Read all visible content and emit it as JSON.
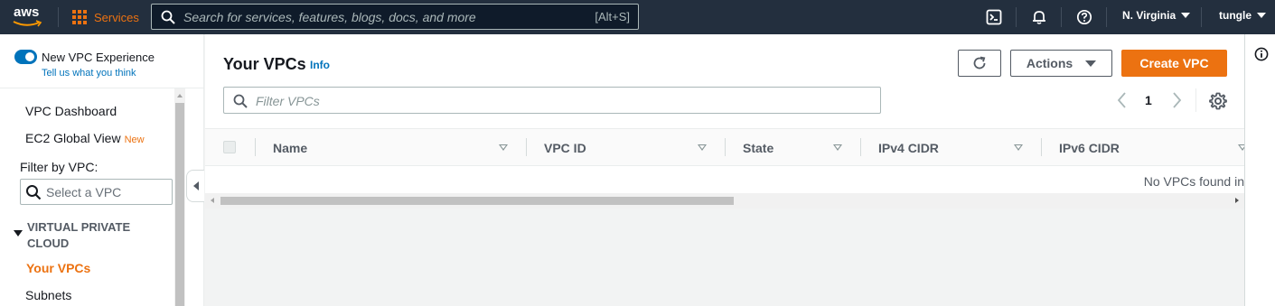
{
  "topnav": {
    "logo_text": "aws",
    "services_label": "Services",
    "search_placeholder": "Search for services, features, blogs, docs, and more",
    "search_shortcut": "[Alt+S]",
    "region": "N. Virginia",
    "user": "tungle",
    "icons": [
      "cloudshell-icon",
      "bell-icon",
      "help-icon"
    ]
  },
  "sidebar": {
    "toggle_label": "New VPC Experience",
    "tell_us": "Tell us what you think",
    "items": [
      {
        "label": "VPC Dashboard"
      },
      {
        "label": "EC2 Global View",
        "badge": "New"
      }
    ],
    "filter_label": "Filter by VPC:",
    "filter_placeholder": "Select a VPC",
    "section_title": "VIRTUAL PRIVATE CLOUD",
    "section_items": [
      {
        "label": "Your VPCs",
        "active": true
      },
      {
        "label": "Subnets",
        "active": false
      }
    ]
  },
  "main": {
    "title": "Your VPCs",
    "info": "Info",
    "actions_label": "Actions",
    "create_label": "Create VPC",
    "filter_placeholder": "Filter VPCs",
    "page": "1",
    "columns": [
      "Name",
      "VPC ID",
      "State",
      "IPv4 CIDR",
      "IPv6 CIDR"
    ],
    "empty_text": "No VPCs found in"
  },
  "colors": {
    "nav_bg": "#232f3e",
    "accent": "#ec7211",
    "link": "#0073bb"
  }
}
